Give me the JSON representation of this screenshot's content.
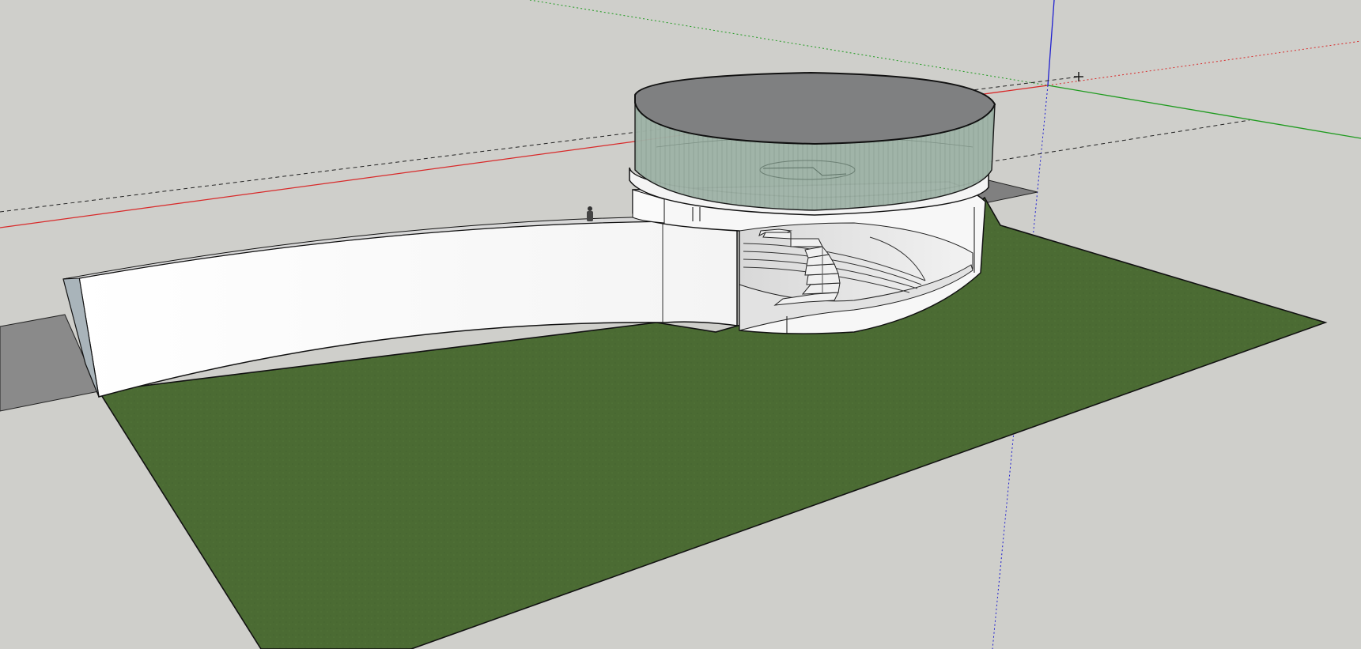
{
  "app": {
    "name": "SketchUp",
    "view": "3d-model-viewport"
  },
  "colors": {
    "background": "#cfcfcb",
    "ground": "#4b6b33",
    "ground_dark": "#3d5a2a",
    "wall": "#ffffff",
    "wall_shade": "#e6e6e6",
    "glass": "#9aaea2",
    "roof": "#7f8081",
    "path": "#8c8c8c",
    "axis_red": "#e0262a",
    "axis_green": "#1f9b1f",
    "axis_blue": "#1f1fd0",
    "edge": "#111111"
  },
  "model": {
    "components": [
      "ground-plane",
      "curved-retaining-wall",
      "circular-pavilion",
      "glass-drum",
      "spiral-staircase",
      "paved-path",
      "human-figure"
    ]
  },
  "axes": {
    "icons": [
      "origin-icon",
      "inference-crosshair-icon"
    ]
  }
}
